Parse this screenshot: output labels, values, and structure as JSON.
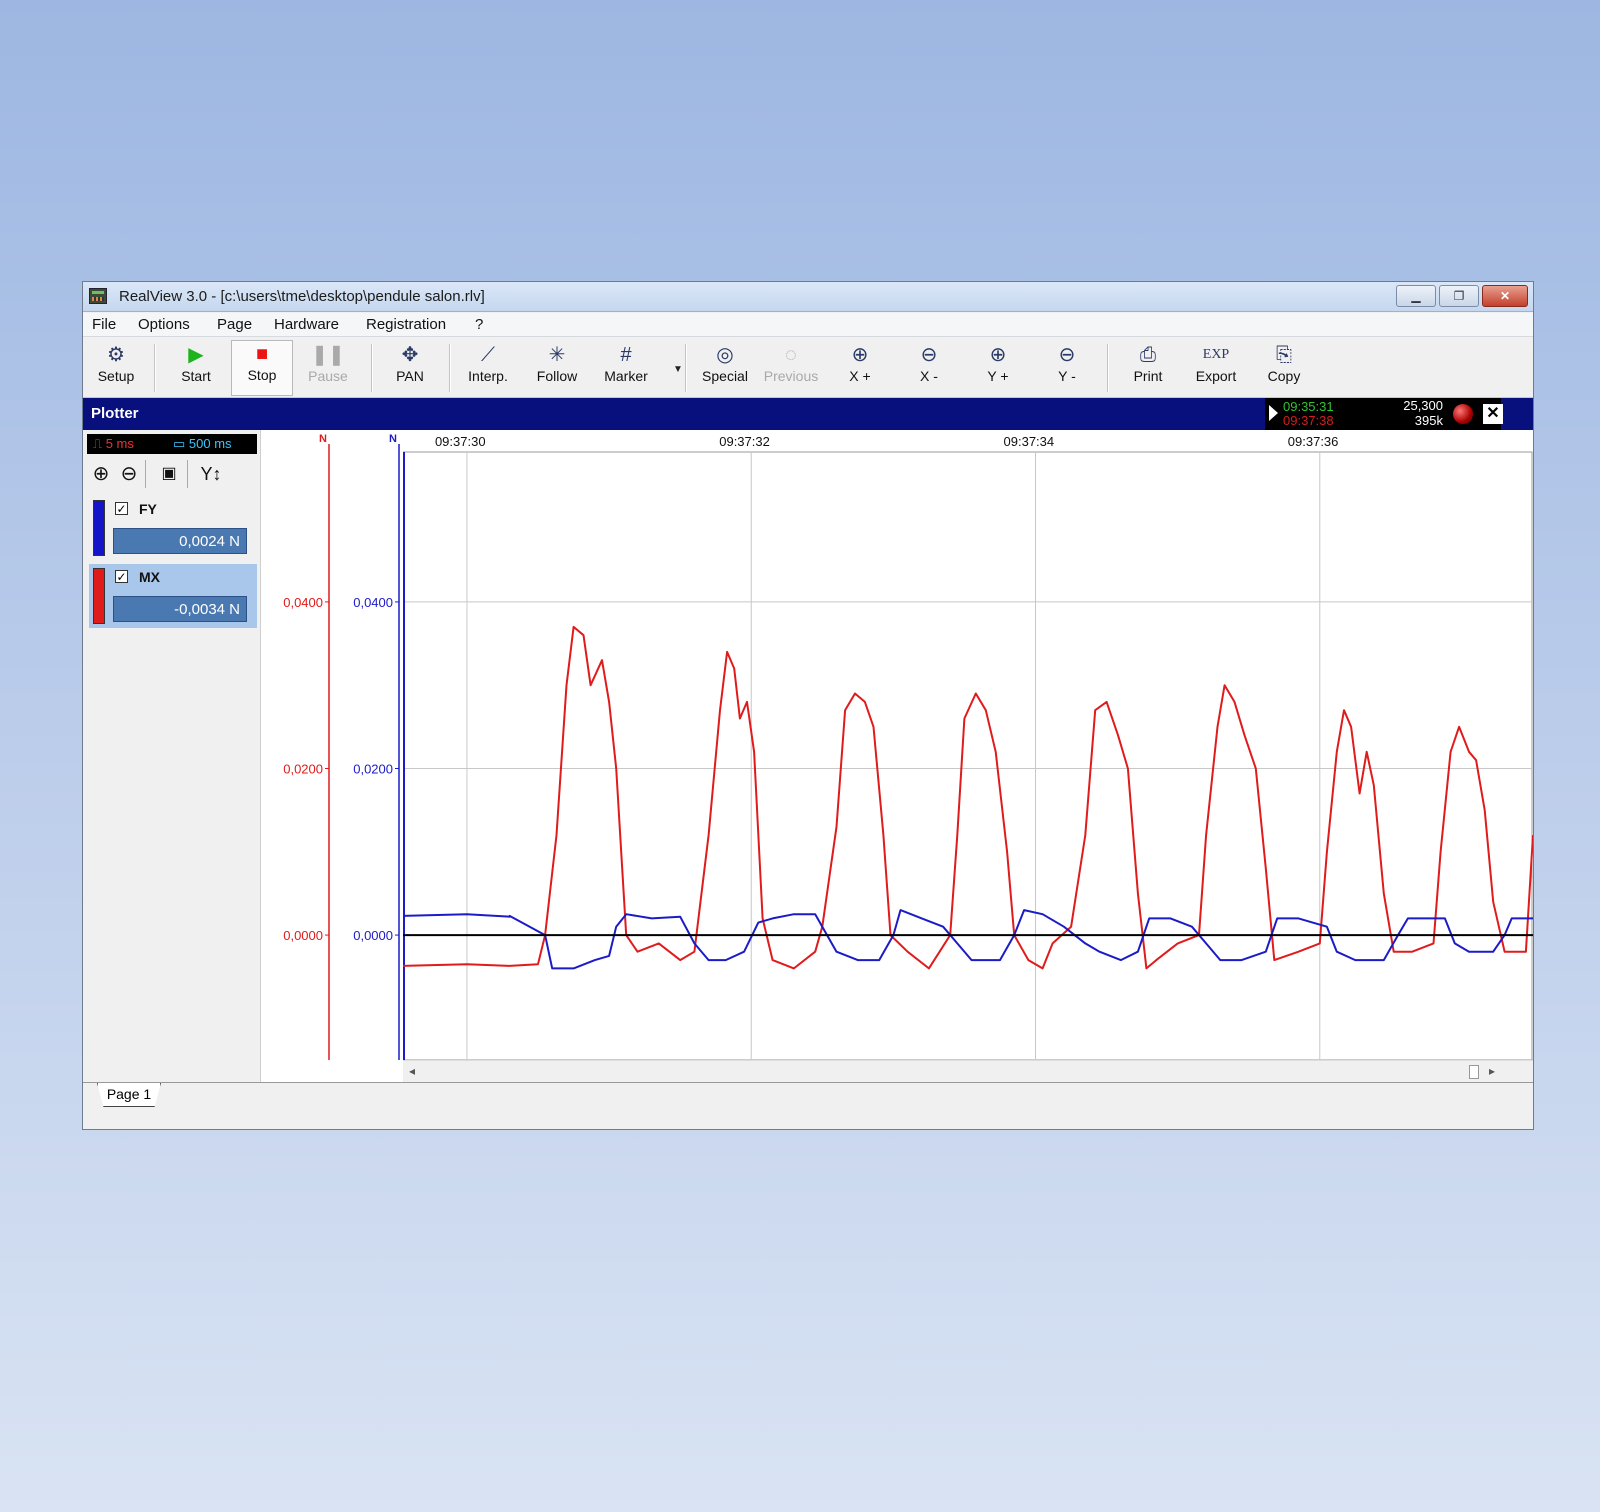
{
  "window": {
    "title": "RealView 3.0 - [c:\\users\\tme\\desktop\\pendule salon.rlv]"
  },
  "menu": [
    "File",
    "Options",
    "Page",
    "Hardware",
    "Registration",
    "?"
  ],
  "toolbar": {
    "setup": "Setup",
    "start": "Start",
    "stop": "Stop",
    "pause": "Pause",
    "pan": "PAN",
    "interp": "Interp.",
    "follow": "Follow",
    "marker": "Marker",
    "special": "Special",
    "previous": "Previous",
    "xplus": "X +",
    "xminus": "X -",
    "yplus": "Y +",
    "yminus": "Y -",
    "print": "Print",
    "export": "Export",
    "copy": "Copy",
    "export_icon_text": "EXP"
  },
  "plotter": {
    "title": "Plotter",
    "time_start": "09:35:31",
    "time_end": "09:37:38",
    "stat_a": "25,300",
    "stat_b": "395k"
  },
  "left": {
    "sample_period": "5 ms",
    "display_period": "500 ms",
    "channels": [
      {
        "name": "FY",
        "value": "0,0024 N",
        "color": "#1414c8",
        "checked": true
      },
      {
        "name": "MX",
        "value": "-0,0034 N",
        "color": "#e01b1b",
        "checked": true
      }
    ]
  },
  "colors": {
    "red": "#e01b1b",
    "blue": "#1b1bc8",
    "zero_line": "#000000",
    "grid": "#c8c8c8"
  },
  "tab": {
    "label": "Page 1"
  },
  "chart_data": {
    "type": "line",
    "x_ticks": [
      "09:37:30",
      "09:37:32",
      "09:37:34",
      "09:37:36"
    ],
    "x_range_s": [
      -0.45,
      7.5
    ],
    "x_tick_s": [
      0,
      2,
      4,
      6
    ],
    "ylim": [
      -0.015,
      0.058
    ],
    "y_unit": "N",
    "y_ticks": [
      "0,0400",
      "0,0200",
      "0,0000"
    ],
    "y_tick_values": [
      0.04,
      0.02,
      0.0
    ],
    "grid": true,
    "series": [
      {
        "name": "MX",
        "color": "#e01b1b",
        "points": [
          [
            -0.45,
            -0.0037
          ],
          [
            0.0,
            -0.0035
          ],
          [
            0.3,
            -0.0037
          ],
          [
            0.3,
            -0.0037
          ],
          [
            0.5,
            -0.0035
          ],
          [
            0.55,
            0.0
          ],
          [
            0.63,
            0.012
          ],
          [
            0.7,
            0.03
          ],
          [
            0.75,
            0.037
          ],
          [
            0.82,
            0.036
          ],
          [
            0.87,
            0.03
          ],
          [
            0.95,
            0.033
          ],
          [
            1.0,
            0.028
          ],
          [
            1.05,
            0.02
          ],
          [
            1.12,
            0.0
          ],
          [
            1.2,
            -0.002
          ],
          [
            1.35,
            -0.001
          ],
          [
            1.5,
            -0.003
          ],
          [
            1.6,
            -0.002
          ],
          [
            1.7,
            0.012
          ],
          [
            1.78,
            0.027
          ],
          [
            1.83,
            0.034
          ],
          [
            1.88,
            0.032
          ],
          [
            1.92,
            0.026
          ],
          [
            1.97,
            0.028
          ],
          [
            2.02,
            0.022
          ],
          [
            2.08,
            0.002
          ],
          [
            2.15,
            -0.003
          ],
          [
            2.3,
            -0.004
          ],
          [
            2.45,
            -0.002
          ],
          [
            2.5,
            0.001
          ],
          [
            2.6,
            0.013
          ],
          [
            2.66,
            0.027
          ],
          [
            2.73,
            0.029
          ],
          [
            2.8,
            0.028
          ],
          [
            2.86,
            0.025
          ],
          [
            2.93,
            0.012
          ],
          [
            2.98,
            0.0
          ],
          [
            3.1,
            -0.002
          ],
          [
            3.25,
            -0.004
          ],
          [
            3.4,
            0.0
          ],
          [
            3.45,
            0.012
          ],
          [
            3.5,
            0.026
          ],
          [
            3.58,
            0.029
          ],
          [
            3.65,
            0.027
          ],
          [
            3.72,
            0.022
          ],
          [
            3.8,
            0.01
          ],
          [
            3.85,
            0.0
          ],
          [
            3.95,
            -0.003
          ],
          [
            4.05,
            -0.004
          ],
          [
            4.12,
            -0.001
          ],
          [
            4.25,
            0.001
          ],
          [
            4.35,
            0.012
          ],
          [
            4.42,
            0.027
          ],
          [
            4.5,
            0.028
          ],
          [
            4.58,
            0.024
          ],
          [
            4.65,
            0.02
          ],
          [
            4.72,
            0.005
          ],
          [
            4.78,
            -0.004
          ],
          [
            4.85,
            -0.003
          ],
          [
            5.0,
            -0.001
          ],
          [
            5.15,
            0.0
          ],
          [
            5.2,
            0.012
          ],
          [
            5.28,
            0.025
          ],
          [
            5.33,
            0.03
          ],
          [
            5.4,
            0.028
          ],
          [
            5.47,
            0.024
          ],
          [
            5.55,
            0.02
          ],
          [
            5.62,
            0.008
          ],
          [
            5.68,
            -0.003
          ],
          [
            5.85,
            -0.002
          ],
          [
            6.0,
            -0.001
          ],
          [
            6.05,
            0.01
          ],
          [
            6.12,
            0.022
          ],
          [
            6.17,
            0.027
          ],
          [
            6.22,
            0.025
          ],
          [
            6.28,
            0.017
          ],
          [
            6.33,
            0.022
          ],
          [
            6.38,
            0.018
          ],
          [
            6.45,
            0.005
          ],
          [
            6.52,
            -0.002
          ],
          [
            6.65,
            -0.002
          ],
          [
            6.8,
            -0.001
          ],
          [
            6.85,
            0.01
          ],
          [
            6.92,
            0.022
          ],
          [
            6.98,
            0.025
          ],
          [
            7.05,
            0.022
          ],
          [
            7.1,
            0.021
          ],
          [
            7.16,
            0.015
          ],
          [
            7.22,
            0.004
          ],
          [
            7.3,
            -0.002
          ],
          [
            7.45,
            -0.002
          ],
          [
            7.5,
            0.012
          ]
        ]
      },
      {
        "name": "FY",
        "color": "#1b1bc8",
        "points": [
          [
            -0.45,
            0.0023
          ],
          [
            0.0,
            0.0025
          ],
          [
            0.3,
            0.0022
          ],
          [
            0.3,
            0.0023
          ],
          [
            0.55,
            0.0
          ],
          [
            0.6,
            -0.004
          ],
          [
            0.75,
            -0.004
          ],
          [
            0.9,
            -0.003
          ],
          [
            1.0,
            -0.0025
          ],
          [
            1.05,
            0.001
          ],
          [
            1.12,
            0.0025
          ],
          [
            1.3,
            0.002
          ],
          [
            1.5,
            0.0022
          ],
          [
            1.6,
            -0.001
          ],
          [
            1.7,
            -0.003
          ],
          [
            1.82,
            -0.003
          ],
          [
            1.95,
            -0.002
          ],
          [
            2.05,
            0.0015
          ],
          [
            2.15,
            0.002
          ],
          [
            2.3,
            0.0025
          ],
          [
            2.45,
            0.0025
          ],
          [
            2.5,
            0.001
          ],
          [
            2.6,
            -0.002
          ],
          [
            2.75,
            -0.003
          ],
          [
            2.9,
            -0.003
          ],
          [
            3.0,
            0.0
          ],
          [
            3.05,
            0.003
          ],
          [
            3.2,
            0.002
          ],
          [
            3.35,
            0.001
          ],
          [
            3.45,
            -0.001
          ],
          [
            3.55,
            -0.003
          ],
          [
            3.75,
            -0.003
          ],
          [
            3.85,
            0.0
          ],
          [
            3.92,
            0.003
          ],
          [
            4.05,
            0.0025
          ],
          [
            4.2,
            0.001
          ],
          [
            4.35,
            -0.001
          ],
          [
            4.45,
            -0.002
          ],
          [
            4.6,
            -0.003
          ],
          [
            4.72,
            -0.002
          ],
          [
            4.8,
            0.002
          ],
          [
            4.95,
            0.002
          ],
          [
            5.1,
            0.001
          ],
          [
            5.2,
            -0.001
          ],
          [
            5.3,
            -0.003
          ],
          [
            5.45,
            -0.003
          ],
          [
            5.62,
            -0.002
          ],
          [
            5.7,
            0.002
          ],
          [
            5.85,
            0.002
          ],
          [
            6.05,
            0.001
          ],
          [
            6.12,
            -0.002
          ],
          [
            6.25,
            -0.003
          ],
          [
            6.45,
            -0.003
          ],
          [
            6.55,
            0.0
          ],
          [
            6.62,
            0.002
          ],
          [
            6.75,
            0.002
          ],
          [
            6.88,
            0.002
          ],
          [
            6.95,
            -0.001
          ],
          [
            7.05,
            -0.002
          ],
          [
            7.22,
            -0.002
          ],
          [
            7.3,
            0.0
          ],
          [
            7.35,
            0.002
          ],
          [
            7.5,
            0.002
          ]
        ]
      }
    ]
  }
}
